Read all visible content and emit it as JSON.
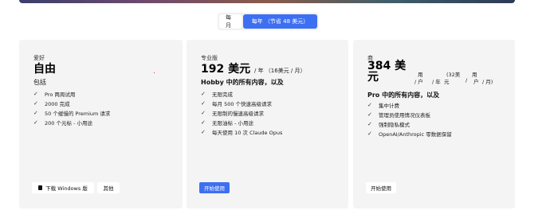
{
  "billing_toggle": {
    "monthly": "每月",
    "yearly": "每年 （节省 48 美元）"
  },
  "plans": [
    {
      "name": "爱好",
      "price": "自由",
      "includes": "包括",
      "features": [
        "Pro 两周试用",
        "2000 完成",
        "50 个缓慢的 Premium 请求",
        "200 个元标 - 小用途"
      ],
      "primary_button": "下载 Windows 版",
      "secondary_button": "其他"
    },
    {
      "name": "专业版",
      "price": "192 美元",
      "price_suffix": "/ 年 （16美元 / 月）",
      "includes": "Hobby 中的所有内容，以及",
      "features": [
        "无限完成",
        "每月 500 个快速高级请求",
        "无限制的慢速高级请求",
        "无限油标 - 小用途",
        "每天使用 10 次 Claude Opus"
      ],
      "button": "开始使用"
    },
    {
      "name": "商",
      "price_line1": "384 美",
      "price_line2": "元",
      "suffix_parts": [
        "用",
        "/ 户",
        "/ 年",
        "元",
        "(32美",
        "用",
        "户",
        "/",
        "/ 月)"
      ],
      "includes": "Pro 中的所有内容，以及",
      "features": [
        "集中计费",
        "管理员使用情况仪表板",
        "强制隐私模式",
        "OpenAI/Anthropic 零数据保留"
      ],
      "button": "开始使用"
    }
  ]
}
